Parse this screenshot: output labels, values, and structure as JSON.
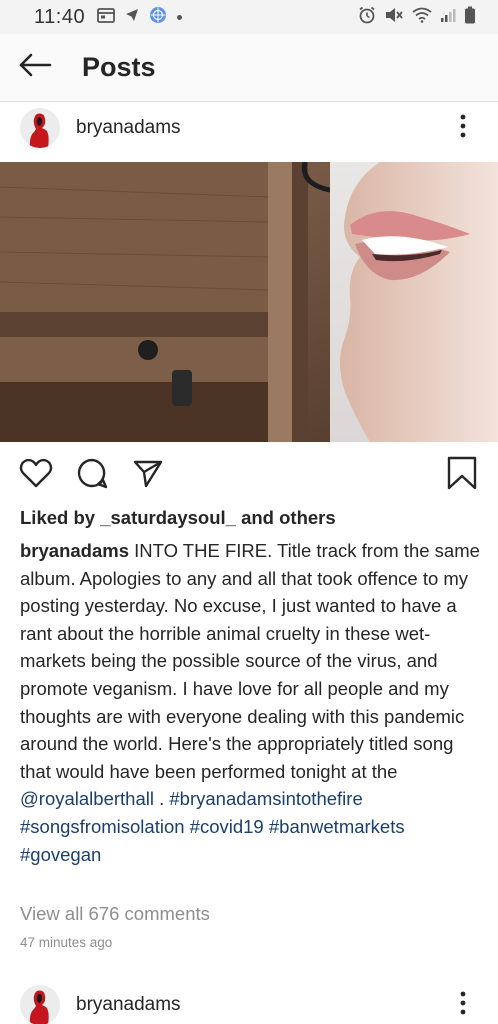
{
  "status_bar": {
    "time": "11:40"
  },
  "app_bar": {
    "title": "Posts"
  },
  "post": {
    "username": "bryanadams",
    "likes_prefix": "Liked by ",
    "likes_user": "_saturdaysoul_",
    "likes_suffix": " and others",
    "caption_user": "bryanadams",
    "caption_text": " INTO THE FIRE. Title track from the same album. Apologies to any and all that took offence to my posting yesterday. No excuse, I just wanted to have a rant about the horrible animal cruelty in these wet-markets being the possible source of the virus, and promote veganism. I have love for all people and my thoughts are with everyone dealing with this pandemic around the world. Here's the appropriately titled song that would have been performed tonight at the ",
    "mention": "@royalalberthall",
    "after_mention": " . ",
    "hashtags": [
      "#bryanadamsintothefire",
      "#songsfromisolation",
      "#covid19",
      "#banwetmarkets",
      "#govegan"
    ],
    "view_comments": "View all 676 comments",
    "time_ago": "47 minutes ago"
  },
  "next_post": {
    "username": "bryanadams"
  },
  "colors": {
    "link": "#1b3f6e",
    "muted": "#8e8e8e",
    "text": "#262626"
  }
}
